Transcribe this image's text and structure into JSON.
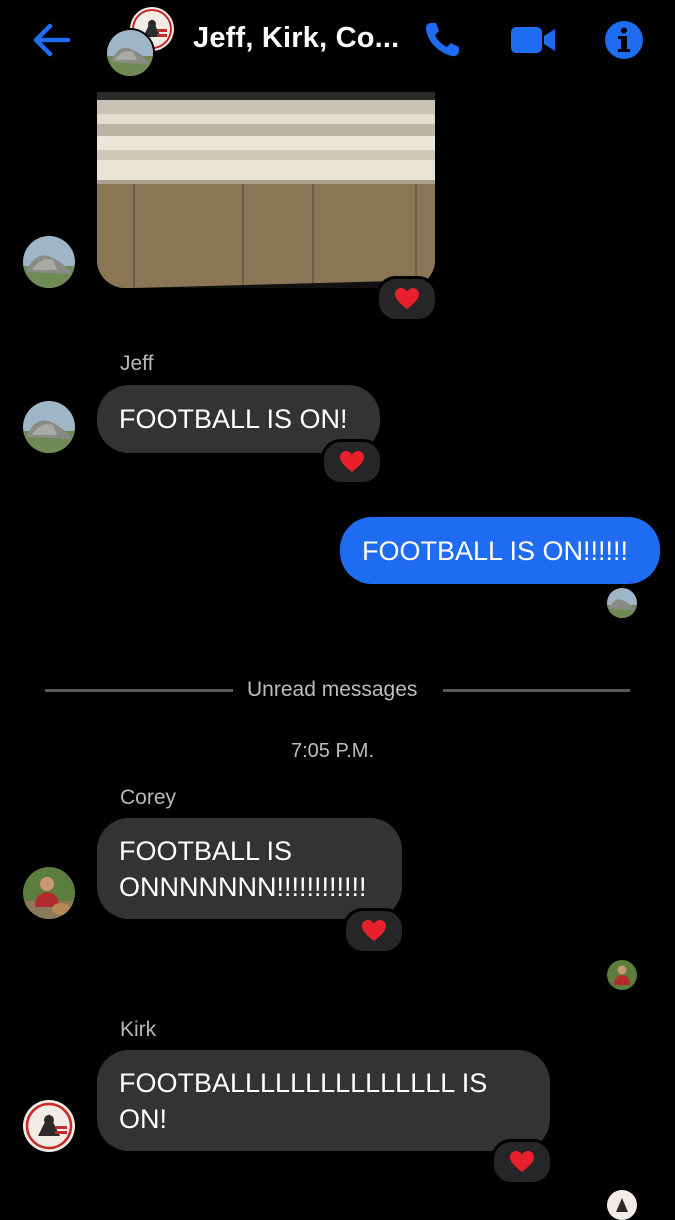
{
  "header": {
    "title": "Jeff, Kirk, Co...",
    "back_icon": "arrow-left-icon",
    "call_icon": "phone-icon",
    "video_icon": "video-camera-icon",
    "info_icon": "info-icon",
    "accent_color": "#1f6cf2"
  },
  "messages": [
    {
      "type": "image",
      "reaction": "heart"
    },
    {
      "sender": "Jeff",
      "text": "FOOTBALL IS ON!",
      "reaction": "heart"
    },
    {
      "sender": "me",
      "text": "FOOTBALL IS ON!!!!!!",
      "outgoing": true
    },
    {
      "sender": "Corey",
      "text": "FOOTBALL IS ONNNNNNN!!!!!!!!!!!!",
      "reaction": "heart"
    },
    {
      "sender": "Kirk",
      "text": "FOOTBALLLLLLLLLLLLLLL IS ON!",
      "reaction": "heart"
    }
  ],
  "divider": {
    "label": "Unread messages"
  },
  "timestamp": "7:05 P.M.",
  "colors": {
    "incoming_bubble": "#333335",
    "outgoing_bubble": "#1f6cf2",
    "heart": "#e8202b"
  }
}
